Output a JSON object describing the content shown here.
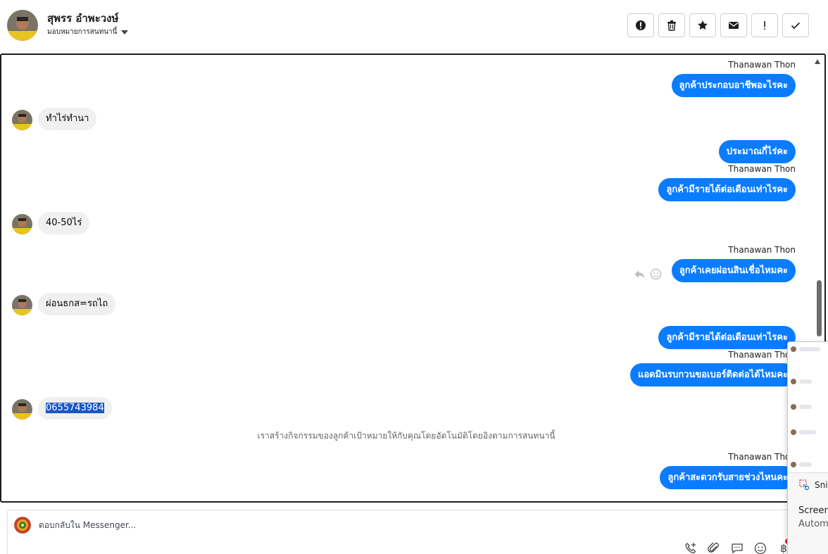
{
  "header": {
    "contact_name": "สุพรร อำพะวงษ์",
    "assign_label": "มอบหมายการสนทนานี้",
    "actions": [
      {
        "name": "spam-button",
        "icon": "alert-circle-icon"
      },
      {
        "name": "delete-button",
        "icon": "trash-icon"
      },
      {
        "name": "star-button",
        "icon": "star-icon"
      },
      {
        "name": "mark-unread-button",
        "icon": "envelope-icon"
      },
      {
        "name": "follow-up-button",
        "icon": "exclamation-icon"
      },
      {
        "name": "mark-done-button",
        "icon": "check-icon"
      }
    ]
  },
  "messages": {
    "m1_sender": "Thanawan Thon",
    "m1_text": "ลูกค้าประกอบอาชีพอะไรคะ",
    "m2_text": "ทำไร่ทำนา",
    "m3_text": "ประมาณกี่ไร่คะ",
    "m4_sender": "Thanawan Thon",
    "m4_text": "ลูกค้ามีรายได้ต่อเดือนเท่าไรคะ",
    "m5_text": "40-50ไร่",
    "m6_sender": "Thanawan Thon",
    "m6_text": "ลูกค้าเคยผ่อนสินเชื่อไหมคะ",
    "m7_text": "ผ่อนธกส=รถไถ",
    "m8_text": "ลูกค้ามีรายได้ต่อเดือนเท่าไรคะ",
    "m9_sender": "Thanawan Thon",
    "m9_text": "แอดมินรบกวนขอเบอร์ติดต่อได้ไหมคะ",
    "m10_text": "0655743984",
    "system_note": "เราสร้างกิจกรรมของลูกค้าเป้าหมายให้กับคุณโดยอัตโนมัติโดยอิงตามการสนทนานี้",
    "m11_sender": "Thanawan Thon",
    "m11_text": "ลูกค้าสะดวกรับสายช่วงไหนคะ"
  },
  "composer": {
    "placeholder": "ตอบกลับใน Messenger...",
    "tools": [
      "phone-plus-icon",
      "paperclip-icon",
      "saved-reply-icon",
      "emoji-icon",
      "baht-icon"
    ],
    "baht_symbol": "฿"
  },
  "snip_overlay": {
    "app_name": "Snip",
    "title": "Screen",
    "subtitle": "Autom"
  },
  "colors": {
    "outgoing_bubble": "#0a7cff",
    "incoming_bubble": "#f0f0f0",
    "selection": "#1a56c4"
  }
}
